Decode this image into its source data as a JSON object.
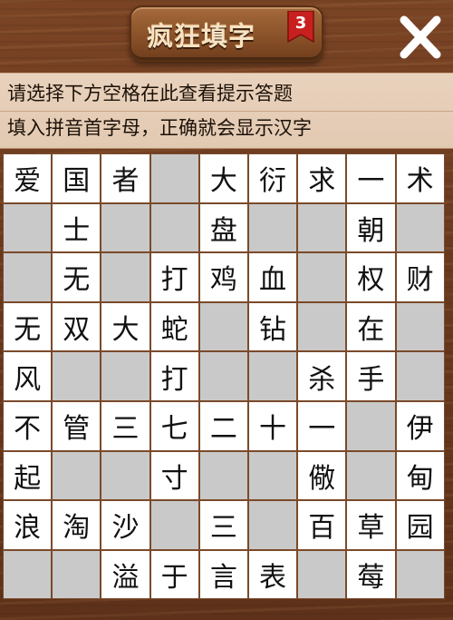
{
  "header": {
    "title": "疯狂填字",
    "level": "3",
    "close_icon": "close-x-icon"
  },
  "hint": {
    "line1": "请选择下方空格在此查看提示答题",
    "line2": "填入拼音首字母，正确就会显示汉字"
  },
  "colors": {
    "wood": "#6b3a1e",
    "hint_bg": "#e6cdb7",
    "cell_filled": "#ffffff",
    "cell_empty": "#c9c9c9",
    "badge_red": "#c8201e"
  },
  "grid": {
    "rows": [
      [
        "爱",
        "国",
        "者",
        "",
        "大",
        "衍",
        "求",
        "一",
        "术"
      ],
      [
        "",
        "士",
        "",
        "",
        "盘",
        "",
        "",
        "朝",
        ""
      ],
      [
        "",
        "无",
        "",
        "打",
        "鸡",
        "血",
        "",
        "权",
        "财"
      ],
      [
        "无",
        "双",
        "大",
        "蛇",
        "",
        "钻",
        "",
        "在",
        ""
      ],
      [
        "风",
        "",
        "",
        "打",
        "",
        "",
        "杀",
        "手",
        ""
      ],
      [
        "不",
        "管",
        "三",
        "七",
        "二",
        "十",
        "一",
        "",
        "伊"
      ],
      [
        "起",
        "",
        "",
        "寸",
        "",
        "",
        "儆",
        "",
        "甸"
      ],
      [
        "浪",
        "淘",
        "沙",
        "",
        "三",
        "",
        "百",
        "草",
        "园"
      ],
      [
        "",
        "",
        "溢",
        "于",
        "言",
        "表",
        "",
        "莓",
        ""
      ]
    ],
    "filled_mask": [
      [
        1,
        1,
        1,
        0,
        1,
        1,
        1,
        1,
        1
      ],
      [
        0,
        1,
        0,
        0,
        1,
        0,
        0,
        1,
        0
      ],
      [
        0,
        1,
        0,
        1,
        1,
        1,
        0,
        1,
        1
      ],
      [
        1,
        1,
        1,
        1,
        0,
        1,
        0,
        1,
        0
      ],
      [
        1,
        0,
        0,
        1,
        0,
        0,
        1,
        1,
        0
      ],
      [
        1,
        1,
        1,
        1,
        1,
        1,
        1,
        0,
        1
      ],
      [
        1,
        0,
        0,
        1,
        0,
        0,
        1,
        0,
        1
      ],
      [
        1,
        1,
        1,
        0,
        1,
        0,
        1,
        1,
        1
      ],
      [
        0,
        0,
        1,
        1,
        1,
        1,
        0,
        1,
        0
      ]
    ]
  }
}
